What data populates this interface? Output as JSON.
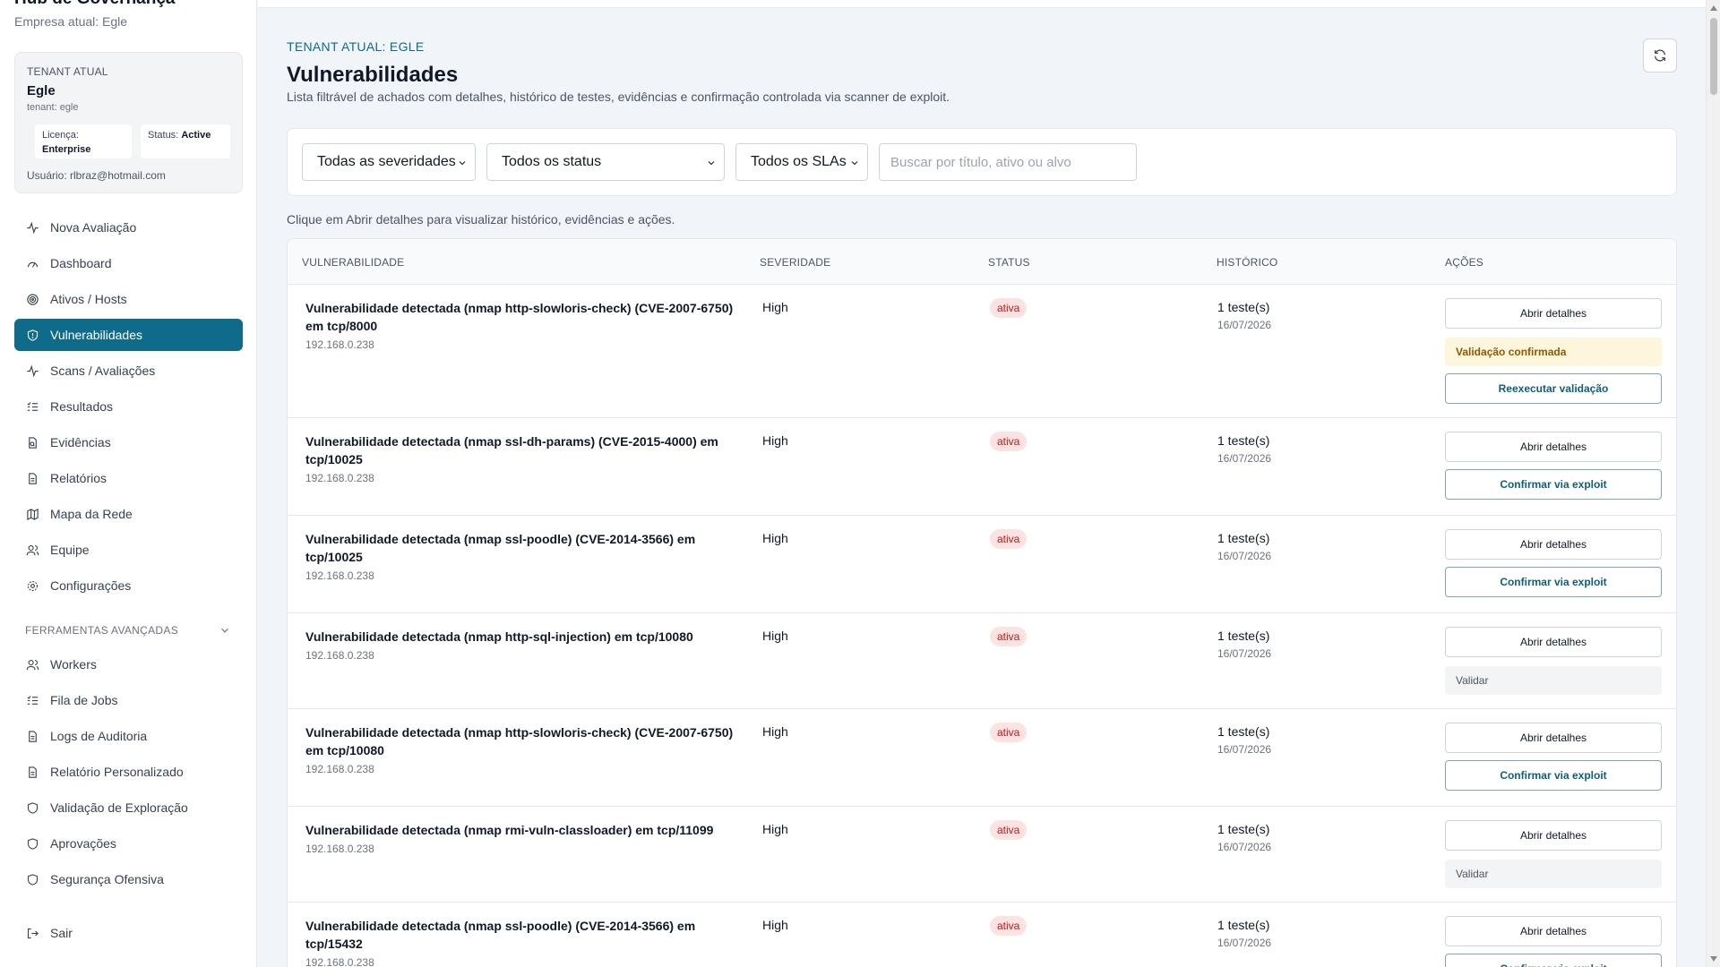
{
  "sidebar": {
    "brand_title": "Hub de Governança",
    "brand_subtitle": "Empresa atual: Egle",
    "tenant": {
      "label": "TENANT ATUAL",
      "name": "Egle",
      "slug": "tenant: egle",
      "license_label": "Licença:",
      "license_value": "Enterprise",
      "status_label": "Status:",
      "status_value": "Active",
      "user": "Usuário: rlbraz@hotmail.com"
    },
    "items": [
      {
        "label": "Nova Avaliação",
        "icon": "activity-icon"
      },
      {
        "label": "Dashboard",
        "icon": "gauge-icon"
      },
      {
        "label": "Ativos / Hosts",
        "icon": "target-icon"
      },
      {
        "label": "Vulnerabilidades",
        "icon": "shield-icon"
      },
      {
        "label": "Scans / Avaliações",
        "icon": "activity-icon"
      },
      {
        "label": "Resultados",
        "icon": "list-check-icon"
      },
      {
        "label": "Evidências",
        "icon": "file-search-icon"
      },
      {
        "label": "Relatórios",
        "icon": "file-text-icon"
      },
      {
        "label": "Mapa da Rede",
        "icon": "map-icon"
      },
      {
        "label": "Equipe",
        "icon": "users-icon"
      },
      {
        "label": "Configurações",
        "icon": "gear-icon"
      }
    ],
    "advanced_label": "FERRAMENTAS AVANÇADAS",
    "advanced_items": [
      {
        "label": "Workers",
        "icon": "users-icon"
      },
      {
        "label": "Fila de Jobs",
        "icon": "list-check-icon"
      },
      {
        "label": "Logs de Auditoria",
        "icon": "file-text-icon"
      },
      {
        "label": "Relatório Personalizado",
        "icon": "file-text-icon"
      },
      {
        "label": "Validação de Exploração",
        "icon": "shield-icon"
      },
      {
        "label": "Aprovações",
        "icon": "shield-icon"
      },
      {
        "label": "Segurança Ofensiva",
        "icon": "shield-icon"
      }
    ],
    "logout": "Sair"
  },
  "header": {
    "eyebrow": "TENANT ATUAL: EGLE",
    "title": "Vulnerabilidades",
    "description": "Lista filtrável de achados com detalhes, histórico de testes, evidências e confirmação controlada via scanner de exploit."
  },
  "filters": {
    "severity": "Todas as severidades",
    "status": "Todos os status",
    "sla": "Todos os SLAs",
    "search_placeholder": "Buscar por título, ativo ou alvo"
  },
  "hint": "Clique em Abrir detalhes para visualizar histórico, evidências e ações.",
  "table": {
    "columns": [
      "VULNERABILIDADE",
      "SEVERIDADE",
      "STATUS",
      "HISTÓRICO",
      "AÇÕES"
    ],
    "rows": [
      {
        "title": "Vulnerabilidade detectada (nmap http-slowloris-check) (CVE-2007-6750) em tcp/8000",
        "host": "192.168.0.238",
        "severity": "High",
        "status": "ativa",
        "history": "1 teste(s)",
        "date": "16/07/2026",
        "details": "Abrir detalhes",
        "state": "Validação confirmada",
        "action": "Reexecutar validação"
      },
      {
        "title": "Vulnerabilidade detectada (nmap ssl-dh-params) (CVE-2015-4000) em tcp/10025",
        "host": "192.168.0.238",
        "severity": "High",
        "status": "ativa",
        "history": "1 teste(s)",
        "date": "16/07/2026",
        "details": "Abrir detalhes",
        "action": "Confirmar via exploit"
      },
      {
        "title": "Vulnerabilidade detectada (nmap ssl-poodle) (CVE-2014-3566) em tcp/10025",
        "host": "192.168.0.238",
        "severity": "High",
        "status": "ativa",
        "history": "1 teste(s)",
        "date": "16/07/2026",
        "details": "Abrir detalhes",
        "action": "Confirmar via exploit"
      },
      {
        "title": "Vulnerabilidade detectada (nmap http-sql-injection) em tcp/10080",
        "host": "192.168.0.238",
        "severity": "High",
        "status": "ativa",
        "history": "1 teste(s)",
        "date": "16/07/2026",
        "details": "Abrir detalhes",
        "state": "Validar"
      },
      {
        "title": "Vulnerabilidade detectada (nmap http-slowloris-check) (CVE-2007-6750) em tcp/10080",
        "host": "192.168.0.238",
        "severity": "High",
        "status": "ativa",
        "history": "1 teste(s)",
        "date": "16/07/2026",
        "details": "Abrir detalhes",
        "action": "Confirmar via exploit"
      },
      {
        "title": "Vulnerabilidade detectada (nmap rmi-vuln-classloader) em tcp/11099",
        "host": "192.168.0.238",
        "severity": "High",
        "status": "ativa",
        "history": "1 teste(s)",
        "date": "16/07/2026",
        "details": "Abrir detalhes",
        "state": "Validar"
      },
      {
        "title": "Vulnerabilidade detectada (nmap ssl-poodle) (CVE-2014-3566) em tcp/15432",
        "host": "192.168.0.238",
        "severity": "High",
        "status": "ativa",
        "history": "1 teste(s)",
        "date": "16/07/2026",
        "details": "Abrir detalhes",
        "action": "Confirmar via exploit"
      }
    ]
  },
  "colors": {
    "accent": "#0f6b8a",
    "danger_badge_bg": "#fde2e2",
    "danger_badge_text": "#b91c1c",
    "confirmed_bg": "#fdf6dc"
  }
}
